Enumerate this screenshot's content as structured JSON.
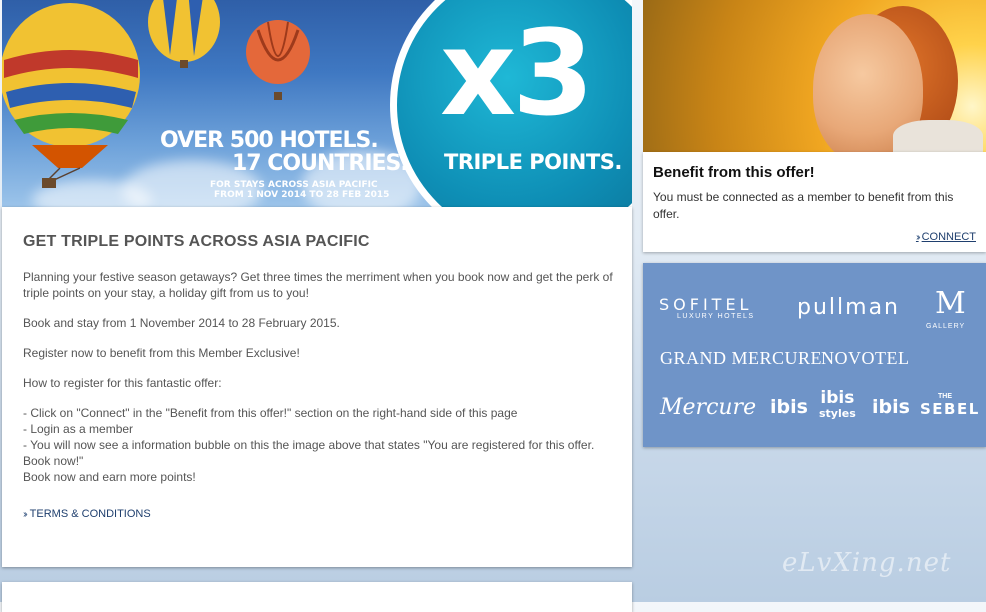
{
  "hero": {
    "multiplier": "x3",
    "triple_points": "TRIPLE POINTS.",
    "line1": "OVER 500 HOTELS.",
    "line2": "17 COUNTRIES.",
    "small1": "FOR STAYS ACROSS ASIA PACIFIC",
    "small2": "FROM 1 NOV 2014 TO 28 FEB 2015"
  },
  "content": {
    "title": "GET TRIPLE POINTS ACROSS ASIA PACIFIC",
    "paragraphs": [
      "Planning your festive season getaways? Get three times the merriment when you book now and get the perk of triple points on your stay, a holiday gift from us to you!",
      "Book and stay from 1 November 2014 to 28 February 2015.",
      "Register now to benefit from this Member Exclusive!",
      "How to register for this fantastic offer:"
    ],
    "steps": [
      "- Click on \"Connect\" in the \"Benefit from this offer!\" section on the right-hand side of this page",
      "- Login as a member",
      "- You will now see a information bubble on this the image above that states \"You are registered for this offer. Book now!\""
    ],
    "closing": "Book now and earn more points!",
    "terms_link": "TERMS & CONDITIONS"
  },
  "benefit": {
    "title": "Benefit from this offer!",
    "text": "You must be connected as a member to benefit from this offer.",
    "connect_link": "CONNECT"
  },
  "brands": {
    "sofitel": "SOFITEL",
    "sofitel_sub": "LUXURY HOTELS",
    "pullman": "pullman",
    "mgallery_mark": "M",
    "mgallery_sub": "GALLERY",
    "grand_mercure": "GRAND MERCURE",
    "novotel": "NOVOTEL",
    "mercure": "Mercure",
    "ibis": "ibis",
    "ibis_styles_top": "ibis",
    "ibis_styles_bottom": "styles",
    "ibis_budget": "ibis",
    "sebel_the": "THE",
    "sebel": "SEBEL"
  },
  "watermark": "eLvXing.net",
  "colors": {
    "accent_teal": "#0e8eb5",
    "link_blue": "#1f3f6e",
    "brands_panel": "#6f94c8"
  }
}
